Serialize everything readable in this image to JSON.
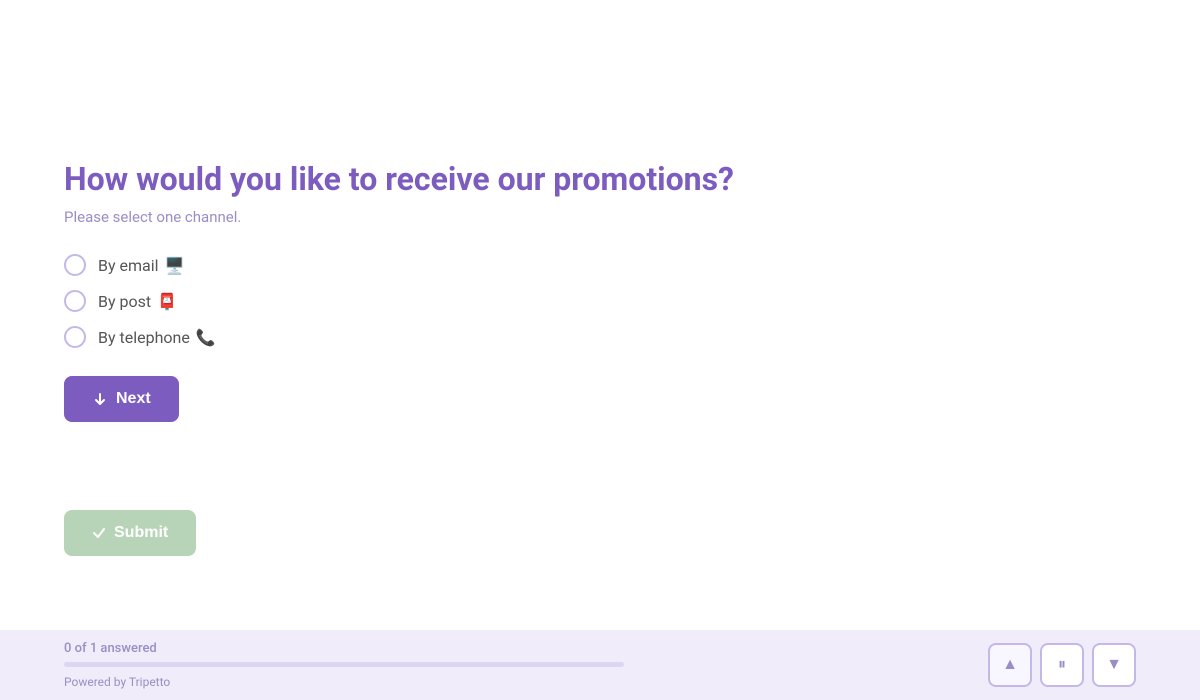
{
  "page": {
    "title": "How would you like to receive our promotions?",
    "subtitle": "Please select one channel.",
    "options": [
      {
        "id": "email",
        "label": "By email",
        "emoji": "🖥️",
        "selected": false
      },
      {
        "id": "post",
        "label": "By post",
        "emoji": "📮",
        "selected": false
      },
      {
        "id": "telephone",
        "label": "By telephone",
        "emoji": "📞",
        "selected": false
      }
    ],
    "next_button": "Next",
    "submit_button": "Submit"
  },
  "footer": {
    "answered_text": "0 of 1 answered",
    "powered_by_label": "Powered by Tripetto",
    "progress_percent": 0,
    "nav": {
      "prev_icon": "▲",
      "pause_icon": "⏸",
      "next_icon": "▼"
    }
  }
}
